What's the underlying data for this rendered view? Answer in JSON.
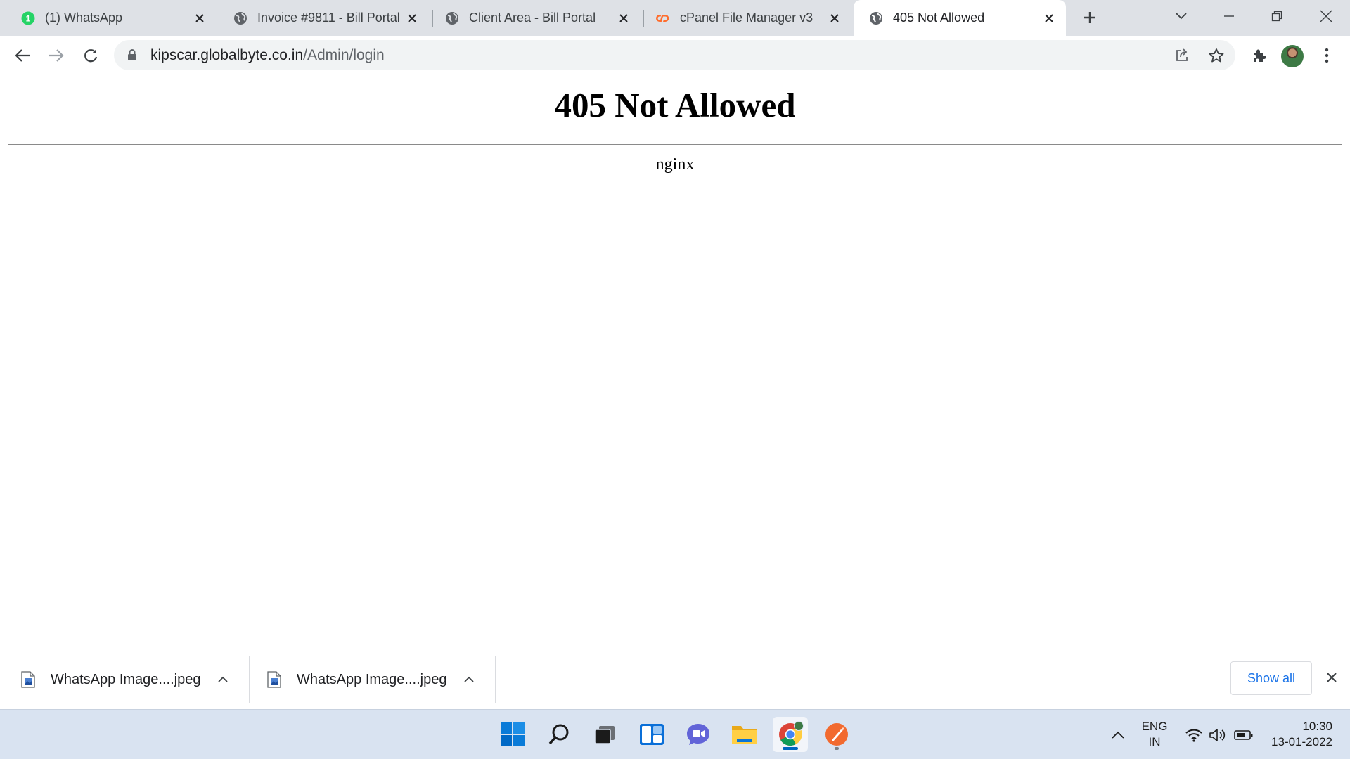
{
  "tabs": [
    {
      "title": "(1) WhatsApp",
      "favicon": "whatsapp-icon",
      "badge": "1",
      "active": false
    },
    {
      "title": "Invoice #9811 - Bill Portal",
      "favicon": "globe-icon",
      "active": false
    },
    {
      "title": "Client Area - Bill Portal",
      "favicon": "globe-icon",
      "active": false
    },
    {
      "title": "cPanel File Manager v3",
      "favicon": "cpanel-icon",
      "active": false
    },
    {
      "title": "405 Not Allowed",
      "favicon": "globe-icon",
      "active": true
    }
  ],
  "address_bar": {
    "host": "kipscar.globalbyte.co.in",
    "path": "/Admin/login"
  },
  "page": {
    "heading": "405 Not Allowed",
    "server": "nginx"
  },
  "downloads": {
    "items": [
      {
        "filename": "WhatsApp Image....jpeg"
      },
      {
        "filename": "WhatsApp Image....jpeg"
      }
    ],
    "show_all_label": "Show all"
  },
  "taskbar": {
    "apps": [
      "start-icon",
      "search-icon",
      "task-view-icon",
      "widgets-icon",
      "teams-chat-icon",
      "file-explorer-icon",
      "chrome-icon",
      "brave-like-app-icon"
    ],
    "language_line1": "ENG",
    "language_line2": "IN",
    "time": "10:30",
    "date": "13-01-2022"
  },
  "colors": {
    "tabstrip_bg": "#dee1e6",
    "omnibox_bg": "#f1f3f4",
    "link_blue": "#1a73e8",
    "taskbar_bg": "#d9e3f1",
    "whatsapp_green": "#25d366",
    "cpanel_orange": "#ff6c2c"
  }
}
